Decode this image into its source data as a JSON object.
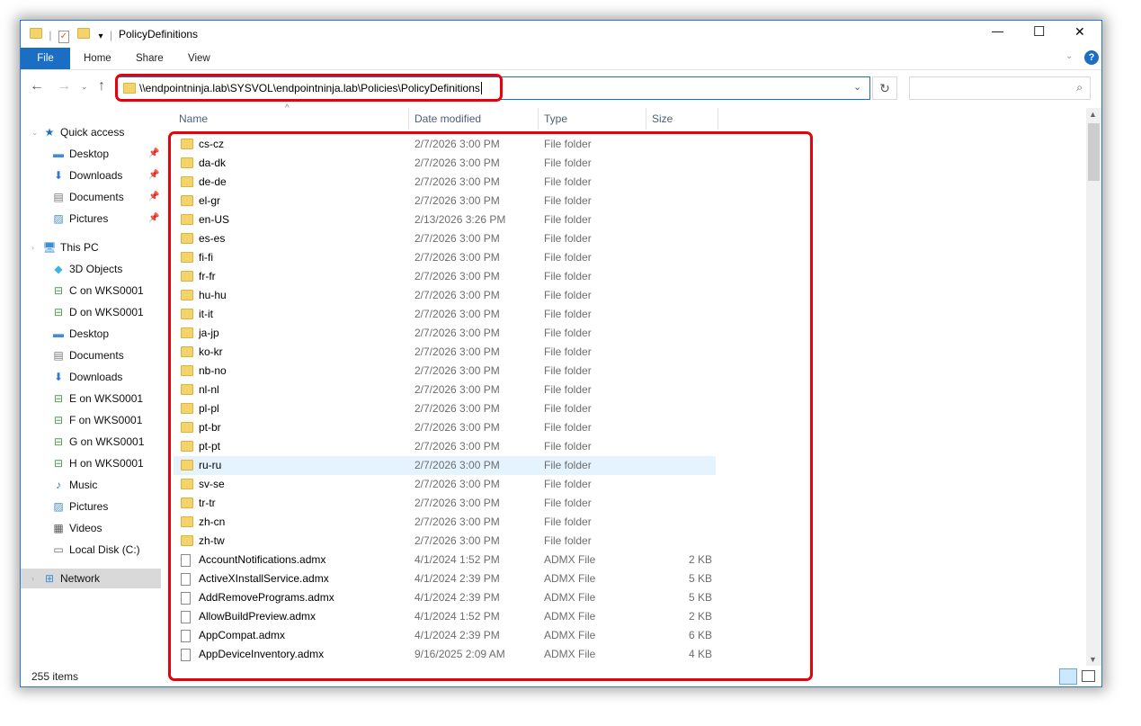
{
  "title_bar": {
    "title": "PolicyDefinitions",
    "minimize": "—",
    "maximize": "☐",
    "close": "✕"
  },
  "ribbon": {
    "tabs": [
      {
        "label": "File"
      },
      {
        "label": "Home"
      },
      {
        "label": "Share"
      },
      {
        "label": "View"
      }
    ]
  },
  "address": {
    "path": "\\\\endpointninja.lab\\SYSVOL\\endpointninja.lab\\Policies\\PolicyDefinitions",
    "search_placeholder": ""
  },
  "columns": {
    "name": "Name",
    "date": "Date modified",
    "type": "Type",
    "size": "Size"
  },
  "sidebar": [
    {
      "label": "Quick access",
      "icon": "star",
      "level": 0,
      "pinned": false
    },
    {
      "label": "Desktop",
      "icon": "desktop",
      "level": 1,
      "pinned": true
    },
    {
      "label": "Downloads",
      "icon": "download",
      "level": 1,
      "pinned": true
    },
    {
      "label": "Documents",
      "icon": "document",
      "level": 1,
      "pinned": true
    },
    {
      "label": "Pictures",
      "icon": "picture",
      "level": 1,
      "pinned": true
    },
    {
      "label": "This PC",
      "icon": "computer",
      "level": 0,
      "pinned": false
    },
    {
      "label": "3D Objects",
      "icon": "cube",
      "level": 1
    },
    {
      "label": "C on WKS0001",
      "icon": "network-drive",
      "level": 1
    },
    {
      "label": "D on WKS0001",
      "icon": "network-drive",
      "level": 1
    },
    {
      "label": "Desktop",
      "icon": "desktop",
      "level": 1
    },
    {
      "label": "Documents",
      "icon": "document",
      "level": 1
    },
    {
      "label": "Downloads",
      "icon": "download",
      "level": 1
    },
    {
      "label": "E on WKS0001",
      "icon": "network-drive",
      "level": 1
    },
    {
      "label": "F on WKS0001",
      "icon": "network-drive",
      "level": 1
    },
    {
      "label": "G on WKS0001",
      "icon": "network-drive",
      "level": 1
    },
    {
      "label": "H on WKS0001",
      "icon": "network-drive",
      "level": 1
    },
    {
      "label": "Music",
      "icon": "music",
      "level": 1
    },
    {
      "label": "Pictures",
      "icon": "picture",
      "level": 1
    },
    {
      "label": "Videos",
      "icon": "video",
      "level": 1
    },
    {
      "label": "Local Disk (C:)",
      "icon": "disk",
      "level": 1
    },
    {
      "label": "Network",
      "icon": "network",
      "level": 0,
      "selected": true
    }
  ],
  "files": [
    {
      "name": "cs-cz",
      "date": "2/7/2026 3:00 PM",
      "type": "File folder",
      "size": ""
    },
    {
      "name": "da-dk",
      "date": "2/7/2026 3:00 PM",
      "type": "File folder",
      "size": ""
    },
    {
      "name": "de-de",
      "date": "2/7/2026 3:00 PM",
      "type": "File folder",
      "size": ""
    },
    {
      "name": "el-gr",
      "date": "2/7/2026 3:00 PM",
      "type": "File folder",
      "size": ""
    },
    {
      "name": "en-US",
      "date": "2/13/2026 3:26 PM",
      "type": "File folder",
      "size": ""
    },
    {
      "name": "es-es",
      "date": "2/7/2026 3:00 PM",
      "type": "File folder",
      "size": ""
    },
    {
      "name": "fi-fi",
      "date": "2/7/2026 3:00 PM",
      "type": "File folder",
      "size": ""
    },
    {
      "name": "fr-fr",
      "date": "2/7/2026 3:00 PM",
      "type": "File folder",
      "size": ""
    },
    {
      "name": "hu-hu",
      "date": "2/7/2026 3:00 PM",
      "type": "File folder",
      "size": ""
    },
    {
      "name": "it-it",
      "date": "2/7/2026 3:00 PM",
      "type": "File folder",
      "size": ""
    },
    {
      "name": "ja-jp",
      "date": "2/7/2026 3:00 PM",
      "type": "File folder",
      "size": ""
    },
    {
      "name": "ko-kr",
      "date": "2/7/2026 3:00 PM",
      "type": "File folder",
      "size": ""
    },
    {
      "name": "nb-no",
      "date": "2/7/2026 3:00 PM",
      "type": "File folder",
      "size": ""
    },
    {
      "name": "nl-nl",
      "date": "2/7/2026 3:00 PM",
      "type": "File folder",
      "size": ""
    },
    {
      "name": "pl-pl",
      "date": "2/7/2026 3:00 PM",
      "type": "File folder",
      "size": ""
    },
    {
      "name": "pt-br",
      "date": "2/7/2026 3:00 PM",
      "type": "File folder",
      "size": ""
    },
    {
      "name": "pt-pt",
      "date": "2/7/2026 3:00 PM",
      "type": "File folder",
      "size": ""
    },
    {
      "name": "ru-ru",
      "date": "2/7/2026 3:00 PM",
      "type": "File folder",
      "size": "",
      "hover": true
    },
    {
      "name": "sv-se",
      "date": "2/7/2026 3:00 PM",
      "type": "File folder",
      "size": ""
    },
    {
      "name": "tr-tr",
      "date": "2/7/2026 3:00 PM",
      "type": "File folder",
      "size": ""
    },
    {
      "name": "zh-cn",
      "date": "2/7/2026 3:00 PM",
      "type": "File folder",
      "size": ""
    },
    {
      "name": "zh-tw",
      "date": "2/7/2026 3:00 PM",
      "type": "File folder",
      "size": ""
    },
    {
      "name": "AccountNotifications.admx",
      "date": "4/1/2024 1:52 PM",
      "type": "ADMX File",
      "size": "2 KB"
    },
    {
      "name": "ActiveXInstallService.admx",
      "date": "4/1/2024 2:39 PM",
      "type": "ADMX File",
      "size": "5 KB"
    },
    {
      "name": "AddRemovePrograms.admx",
      "date": "4/1/2024 2:39 PM",
      "type": "ADMX File",
      "size": "5 KB"
    },
    {
      "name": "AllowBuildPreview.admx",
      "date": "4/1/2024 1:52 PM",
      "type": "ADMX File",
      "size": "2 KB"
    },
    {
      "name": "AppCompat.admx",
      "date": "4/1/2024 2:39 PM",
      "type": "ADMX File",
      "size": "6 KB"
    },
    {
      "name": "AppDeviceInventory.admx",
      "date": "9/16/2025 2:09 AM",
      "type": "ADMX File",
      "size": "4 KB"
    }
  ],
  "status": {
    "item_count": "255 items"
  },
  "colors": {
    "accent": "#1a6fc4",
    "annotation": "#e8000b",
    "selected": "#cce8ff",
    "hover": "#e5f3ff"
  }
}
